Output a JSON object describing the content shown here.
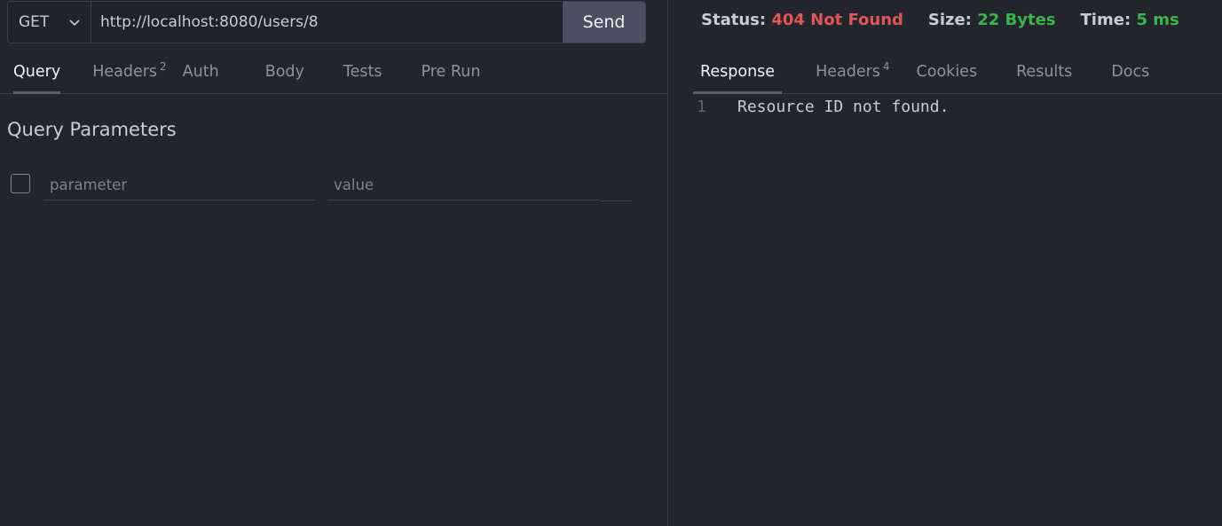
{
  "request": {
    "method": "GET",
    "url": "http://localhost:8080/users/8",
    "send_label": "Send"
  },
  "request_tabs": [
    {
      "label": "Query",
      "badge": "",
      "active": true
    },
    {
      "label": "Headers",
      "badge": "2",
      "active": false
    },
    {
      "label": "Auth",
      "badge": "",
      "active": false
    },
    {
      "label": "Body",
      "badge": "",
      "active": false
    },
    {
      "label": "Tests",
      "badge": "",
      "active": false
    },
    {
      "label": "Pre Run",
      "badge": "",
      "active": false
    }
  ],
  "query": {
    "title": "Query Parameters",
    "param_placeholder": "parameter",
    "value_placeholder": "value"
  },
  "response_status": {
    "status_label": "Status:",
    "status_value": "404 Not Found",
    "size_label": "Size:",
    "size_value": "22 Bytes",
    "time_label": "Time:",
    "time_value": "5 ms"
  },
  "response_tabs": [
    {
      "label": "Response",
      "badge": "",
      "active": true
    },
    {
      "label": "Headers",
      "badge": "4",
      "active": false
    },
    {
      "label": "Cookies",
      "badge": "",
      "active": false
    },
    {
      "label": "Results",
      "badge": "",
      "active": false
    },
    {
      "label": "Docs",
      "badge": "",
      "active": false
    }
  ],
  "response_body": {
    "lines": [
      {
        "number": "1",
        "text": "Resource ID not found."
      }
    ]
  },
  "colors": {
    "status_error": "#e05555",
    "status_ok": "#3cb44b",
    "background": "#22252c",
    "send_button": "#4a5060"
  },
  "icons": {
    "method_dropdown": "chevron-down-icon"
  }
}
